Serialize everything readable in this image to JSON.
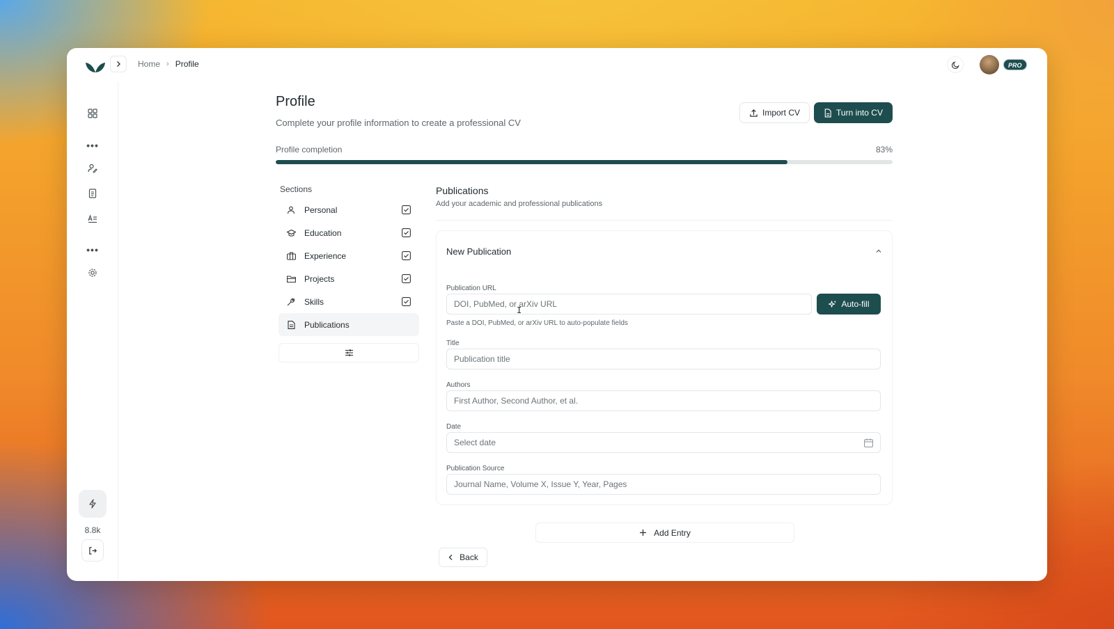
{
  "breadcrumb": {
    "home": "Home",
    "current": "Profile"
  },
  "user": {
    "badge": "PRO"
  },
  "rail": {
    "credits": "8.8k"
  },
  "header": {
    "title": "Profile",
    "subtitle": "Complete your profile information to create a professional CV",
    "import_label": "Import CV",
    "turn_label": "Turn into CV"
  },
  "progress": {
    "label": "Profile completion",
    "value_text": "83%",
    "fraction": 0.83
  },
  "sections": {
    "title": "Sections",
    "items": [
      {
        "label": "Personal",
        "icon": "user-icon",
        "done": true
      },
      {
        "label": "Education",
        "icon": "graduation-cap-icon",
        "done": true
      },
      {
        "label": "Experience",
        "icon": "briefcase-icon",
        "done": true
      },
      {
        "label": "Projects",
        "icon": "folder-icon",
        "done": true
      },
      {
        "label": "Skills",
        "icon": "wrench-icon",
        "done": true
      },
      {
        "label": "Publications",
        "icon": "document-icon",
        "done": false,
        "active": true
      }
    ]
  },
  "publications": {
    "title": "Publications",
    "subtitle": "Add your academic and professional publications",
    "card_title": "New Publication",
    "url": {
      "label": "Publication URL",
      "placeholder": "DOI, PubMed, or arXiv URL",
      "hint": "Paste a DOI, PubMed, or arXiv URL to auto-populate fields"
    },
    "autofill_label": "Auto-fill",
    "title_field": {
      "label": "Title",
      "placeholder": "Publication title"
    },
    "authors": {
      "label": "Authors",
      "placeholder": "First Author, Second Author, et al."
    },
    "date": {
      "label": "Date",
      "placeholder": "Select date"
    },
    "source": {
      "label": "Publication Source",
      "placeholder": "Journal Name, Volume X, Issue Y, Year, Pages"
    },
    "add_entry_label": "Add Entry",
    "back_label": "Back"
  },
  "colors": {
    "accent": "#1e4d4f",
    "track": "#e2e5e6"
  }
}
